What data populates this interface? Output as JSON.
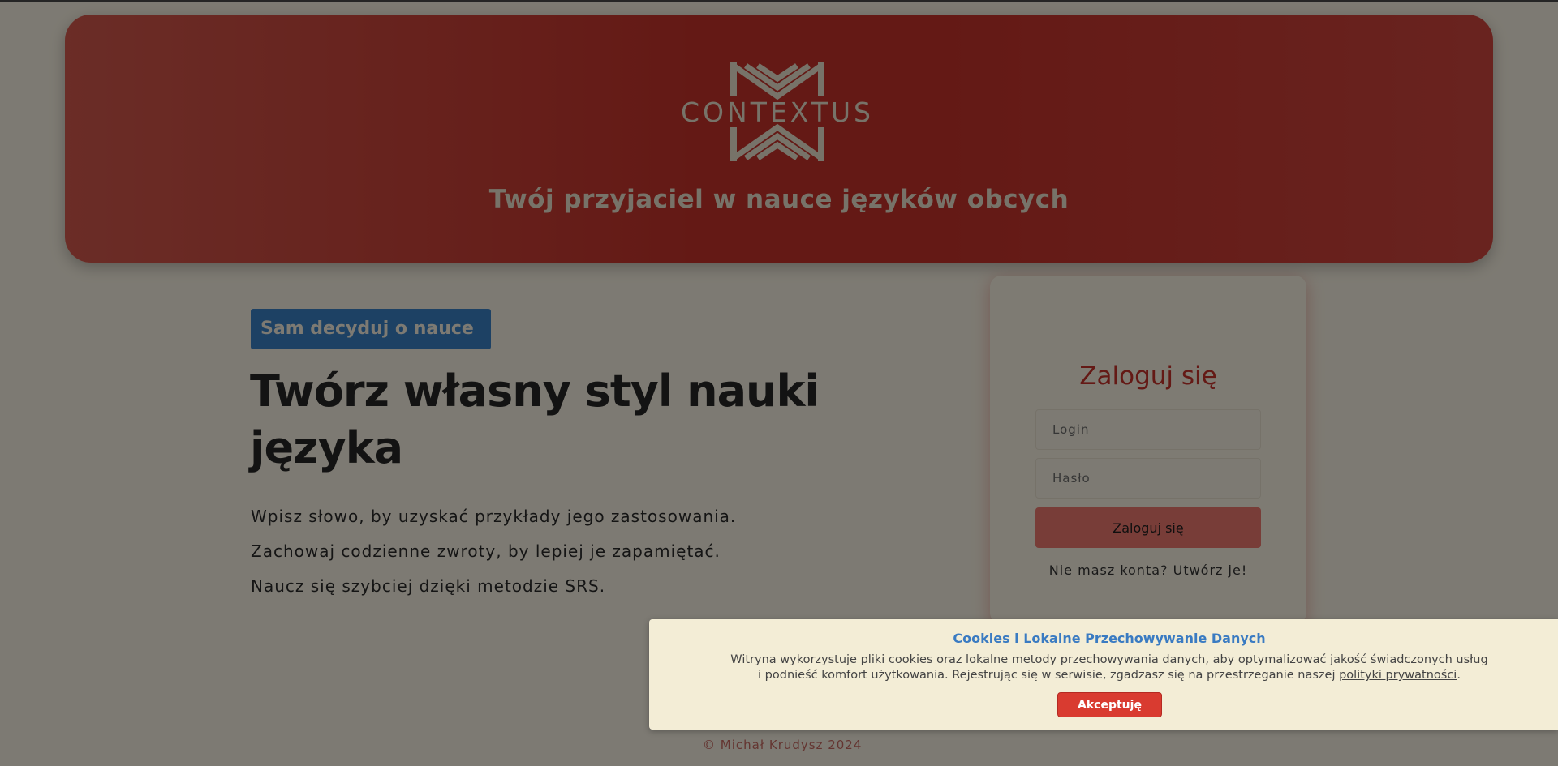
{
  "header": {
    "logo_text": "CONTEXTUS",
    "tagline": "Twój przyjaciel w nauce języków obcych"
  },
  "hero": {
    "badge": "Sam decyduj o nauce",
    "title": "Twórz własny styl nauki języka",
    "lines": [
      "Wpisz słowo, by uzyskać przykłady jego zastosowania.",
      "Zachowaj codzienne zwroty, by lepiej je zapamiętać.",
      "Naucz się szybciej dzięki metodzie SRS."
    ]
  },
  "login": {
    "title": "Zaloguj się",
    "login_placeholder": "Login",
    "password_placeholder": "Hasło",
    "submit_label": "Zaloguj się",
    "register_text": "Nie masz konta? Utwórz je!"
  },
  "footer": {
    "copyright": "© Michał Krudysz 2024"
  },
  "cookie": {
    "title": "Cookies i Lokalne Przechowywanie Danych",
    "text_before_link": "Witryna wykorzystuje pliki cookies oraz lokalne metody przechowywania danych, aby optymalizować jakość świadczonych usług i podnieść komfort użytkowania. Rejestrując się w serwisie, zgadzasz się na przestrzeganie naszej ",
    "link_text": "polityki prywatności",
    "text_after_link": ".",
    "accept_label": "Akceptuję"
  },
  "colors": {
    "brand_red": "#c8322a",
    "accent_blue": "#3a82c9",
    "page_background": "#fbf5e6",
    "button_salmon": "#f07a70"
  }
}
